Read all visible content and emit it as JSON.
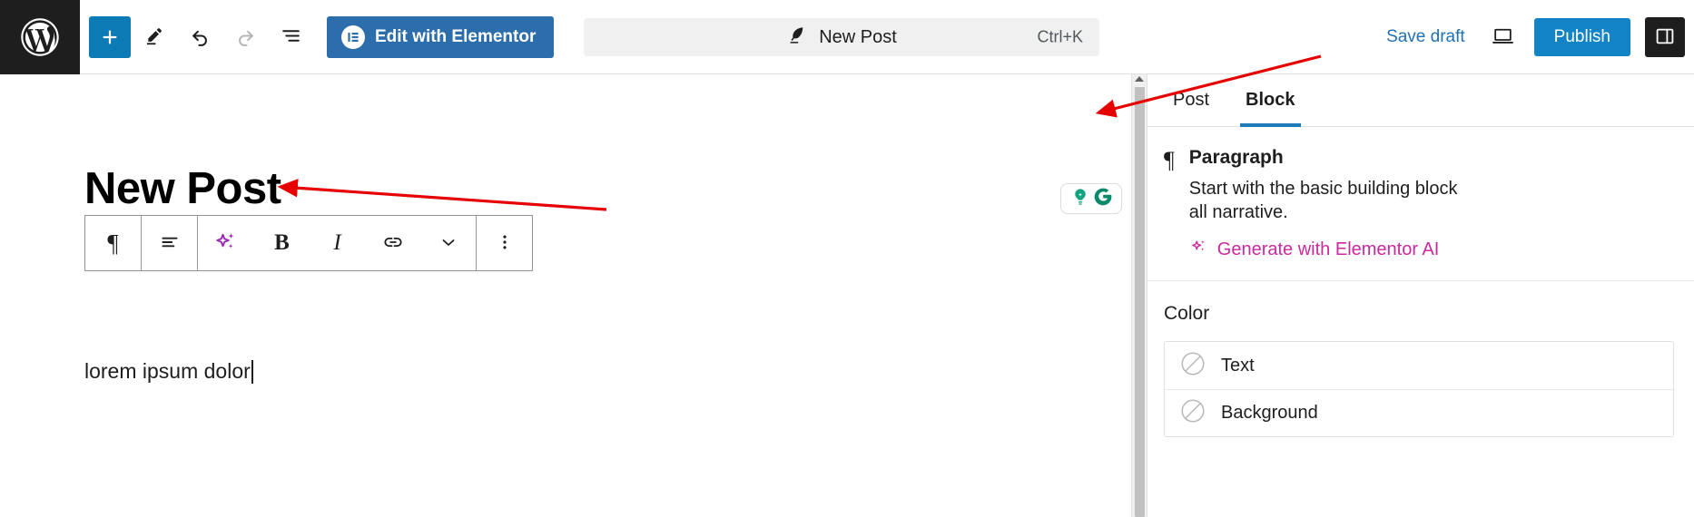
{
  "header": {
    "wp_logo": "wordpress-logo",
    "tools": [
      {
        "name": "add-block-button",
        "label": "+",
        "icon": "plus-icon"
      },
      {
        "name": "tools-pen-button",
        "label": "",
        "icon": "pencil-icon"
      },
      {
        "name": "undo-button",
        "label": "",
        "icon": "undo-arrow-icon"
      },
      {
        "name": "redo-button",
        "label": "",
        "icon": "redo-arrow-icon"
      },
      {
        "name": "list-view-button",
        "label": "",
        "icon": "list-view-icon"
      }
    ],
    "elementor_button": "Edit with Elementor",
    "command_bar": {
      "title": "New Post",
      "shortcut": "Ctrl+K",
      "icon": "quill-pen-icon"
    },
    "save_draft": "Save draft",
    "preview_icon": "laptop-preview-icon",
    "publish": "Publish",
    "sidebar_toggle_icon": "sidebar-panel-icon"
  },
  "editor": {
    "post_title": "New Post",
    "paragraph_text": "lorem ipsum dolor",
    "block_toolbar": [
      {
        "name": "block-type-paragraph-button",
        "glyph": "¶",
        "icon": "paragraph-icon"
      },
      {
        "name": "align-text-button",
        "glyph": "",
        "icon": "align-left-icon"
      },
      {
        "name": "elementor-ai-button",
        "glyph": "",
        "icon": "ai-sparkles-icon"
      },
      {
        "name": "bold-button",
        "glyph": "B",
        "icon": "bold-icon"
      },
      {
        "name": "italic-button",
        "glyph": "I",
        "icon": "italic-icon"
      },
      {
        "name": "link-button",
        "glyph": "",
        "icon": "link-icon"
      },
      {
        "name": "more-formatting-button",
        "glyph": "",
        "icon": "chevron-down-icon"
      },
      {
        "name": "block-options-button",
        "glyph": "",
        "icon": "vertical-dots-icon"
      }
    ],
    "grammarly": {
      "name": "grammarly-widget",
      "icons": [
        "lightbulb-icon",
        "grammarly-g-icon"
      ]
    }
  },
  "sidebar": {
    "tabs": [
      {
        "label": "Post",
        "active": false
      },
      {
        "label": "Block",
        "active": true
      }
    ],
    "block": {
      "icon": "paragraph-icon",
      "title": "Paragraph",
      "description_line1": "Start with the basic building block",
      "description_line2": "all narrative.",
      "ai_link": "Generate with Elementor AI",
      "ai_icon": "ai-sparkles-icon"
    },
    "color": {
      "heading": "Color",
      "rows": [
        {
          "label": "Text",
          "swatch": "none"
        },
        {
          "label": "Background",
          "swatch": "none"
        }
      ]
    }
  },
  "colors": {
    "wp_admin_dark": "#1e1e1e",
    "accent_blue": "#1283c4",
    "elementor_blue": "#2c6eab",
    "link_blue": "#2271b1",
    "ai_purple": "#9b26b6",
    "ai_magenta": "#cc2a9c",
    "grammarly_green": "#0a8a6b",
    "annotation_red": "#e60000"
  },
  "annotations": [
    {
      "name": "arrow-to-publish",
      "color": "#e60000"
    },
    {
      "name": "arrow-to-post-title",
      "color": "#e60000"
    }
  ]
}
